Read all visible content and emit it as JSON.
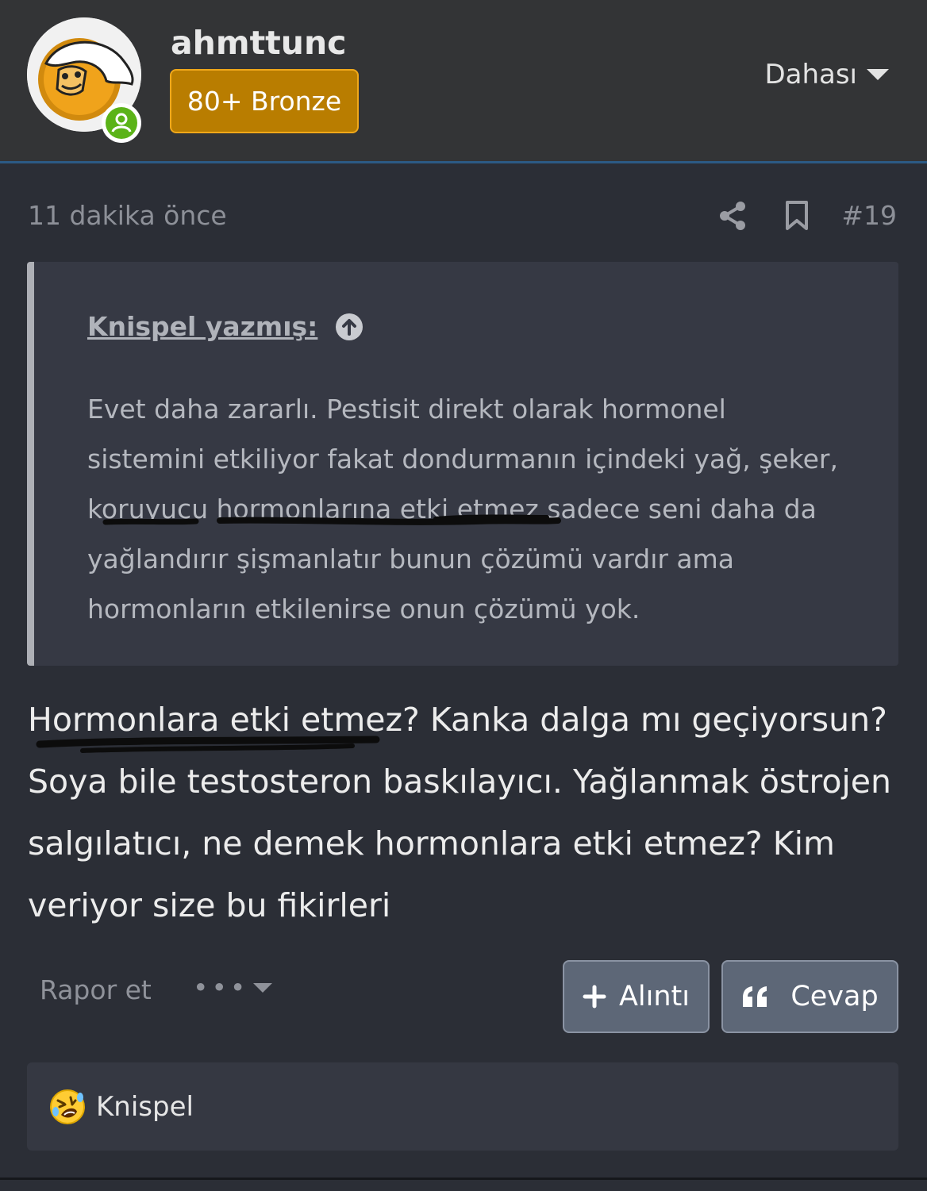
{
  "header": {
    "username": "ahmttunc",
    "badge": "80+ Bronze",
    "more_label": "Dahası"
  },
  "meta": {
    "timestamp": "11 dakika önce",
    "post_number": "#19"
  },
  "quote": {
    "author": "Knispel yazmış:",
    "lines": [
      "Evet daha zararlı. Pestisit direkt olarak hormonel",
      "sistemini etkiliyor fakat dondurmanın içindeki yağ, şeker,",
      "koruyucu hormonlarına etki etmez sadece seni daha da",
      "yağlandırır şişmanlatır bunun çözümü vardır ama",
      "hormonların etkilenirse onun çözümü yok."
    ]
  },
  "body": {
    "lines": [
      "Hormonlara etki etmez? Kanka dalga mı geçiyorsun?",
      "Soya bile testosteron baskılayıcı. Yağlanmak östrojen",
      "salgılatıcı, ne demek hormonlara etki etmez? Kim",
      "veriyor size bu fikirleri"
    ]
  },
  "actions": {
    "report": "Rapor et",
    "more": "•••",
    "quote_button": "Alıntı",
    "reply_button": "Cevap"
  },
  "reactions": {
    "user": "Knispel",
    "emoji": "rolling-on-floor-laughing-icon"
  },
  "colors": {
    "badge_bg": "#b97d00",
    "online": "#5bb318",
    "accent_line": "#2c5a85"
  }
}
